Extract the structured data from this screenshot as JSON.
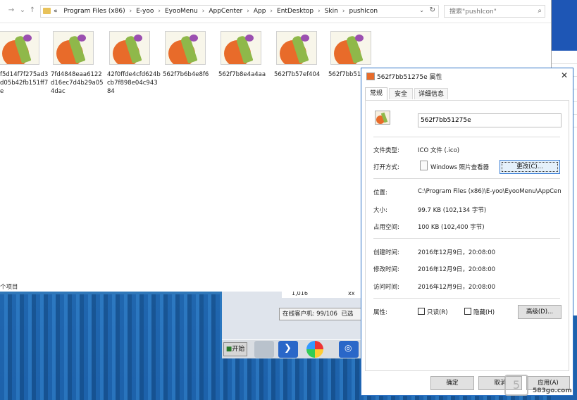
{
  "explorer": {
    "breadcrumb_prefix": "«",
    "breadcrumbs": [
      "Program Files (x86)",
      "E-yoo",
      "EyooMenu",
      "AppCenter",
      "App",
      "EntDesktop",
      "Skin",
      "pushIcon"
    ],
    "search_placeholder": "搜索\"pushIcon\"",
    "files": [
      {
        "name": "f5d14f7f275ad3d05b42fb151ff7e"
      },
      {
        "name": "7fd4848eaa6122d16ec7d4b29a054dac"
      },
      {
        "name": "42f0ffde4cfd624bcb7f898e04c94384"
      },
      {
        "name": "562f7b6b4e8f6"
      },
      {
        "name": "562f7b8e4a4aa"
      },
      {
        "name": "562f7b57ef404"
      },
      {
        "name": "562f7bb51"
      }
    ],
    "item_count": "个项目"
  },
  "background": {
    "row_value": "1,016",
    "row_value2": "xx",
    "clients": "在线客户机: 99/106",
    "clients_suffix": "已选",
    "start_label": "开始"
  },
  "dialog": {
    "title": "562f7bb51275e 属性",
    "tabs": [
      "常规",
      "安全",
      "详细信息"
    ],
    "filename": "562f7bb51275e",
    "fields": {
      "type_label": "文件类型:",
      "type_value": "ICO 文件 (.ico)",
      "open_label": "打开方式:",
      "open_value": "Windows 照片查看器",
      "change_button": "更改(C)...",
      "location_label": "位置:",
      "location_value": "C:\\Program Files (x86)\\E-yoo\\EyooMenu\\AppCen",
      "size_label": "大小:",
      "size_value": "99.7 KB (102,134 字节)",
      "disk_label": "占用空间:",
      "disk_value": "100 KB (102,400 字节)",
      "created_label": "创建时间:",
      "created_value": "2016年12月9日，20:08:00",
      "modified_label": "修改时间:",
      "modified_value": "2016年12月9日，20:08:00",
      "accessed_label": "访问时间:",
      "accessed_value": "2016年12月9日，20:08:00",
      "attr_label": "属性:",
      "readonly_label": "只读(R)",
      "hidden_label": "隐藏(H)",
      "advanced_button": "高级(D)..."
    },
    "buttons": {
      "ok": "确定",
      "cancel": "取消",
      "apply": "应用(A)"
    }
  },
  "watermark": {
    "text": "583go.com"
  },
  "colors": {
    "dialog_border": "#2e73c6",
    "desktop": "#1f5fa8",
    "accent_button": "#e5f1fb"
  }
}
